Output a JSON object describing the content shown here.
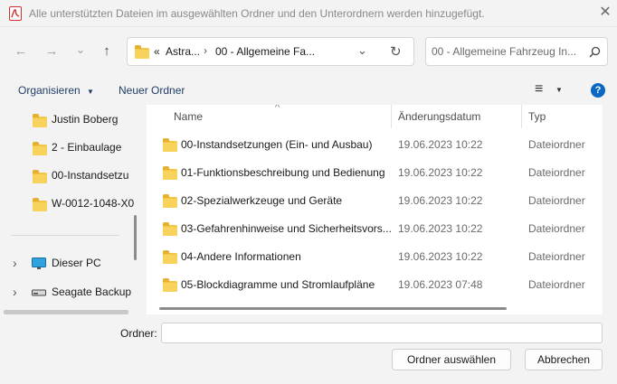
{
  "window": {
    "title": "Alle unterstützten Dateien im ausgewählten Ordner und den Unterordnern werden hinzugefügt.",
    "close_glyph": "✕"
  },
  "nav": {
    "back_glyph": "←",
    "forward_glyph": "→",
    "recent_glyph": "⌄",
    "up_glyph": "↑"
  },
  "address": {
    "overflow": "«",
    "crumbs": [
      "Astra...",
      "00 - Allgemeine Fa..."
    ],
    "separator": "›",
    "dropdown_glyph": "⌄",
    "refresh_glyph": "↻"
  },
  "search": {
    "placeholder": "00 - Allgemeine Fahrzeug In...",
    "icon": "search-icon"
  },
  "commands": {
    "organize": "Organisieren",
    "new_folder": "Neuer Ordner",
    "view_glyph": "≡",
    "help_glyph": "?"
  },
  "sidebar": {
    "folders": [
      "Justin Boberg",
      "2 - Einbaulage",
      "00-Instandsetzu",
      "W-0012-1048-X0"
    ],
    "devices": [
      {
        "label": "Dieser PC",
        "icon": "monitor-icon"
      },
      {
        "label": "Seagate Backup",
        "icon": "drive-icon"
      }
    ],
    "expand_glyph": "›"
  },
  "table": {
    "sort_glyph": "^",
    "headers": {
      "name": "Name",
      "date": "Änderungsdatum",
      "type": "Typ"
    },
    "rows": [
      {
        "name": "00-Instandsetzungen (Ein- und Ausbau)",
        "date": "19.06.2023 10:22",
        "type": "Dateiordner"
      },
      {
        "name": "01-Funktionsbeschreibung und Bedienung",
        "date": "19.06.2023 10:22",
        "type": "Dateiordner"
      },
      {
        "name": "02-Spezialwerkzeuge und Geräte",
        "date": "19.06.2023 10:22",
        "type": "Dateiordner"
      },
      {
        "name": "03-Gefahrenhinweise und Sicherheitsvors...",
        "date": "19.06.2023 10:22",
        "type": "Dateiordner"
      },
      {
        "name": "04-Andere Informationen",
        "date": "19.06.2023 10:22",
        "type": "Dateiordner"
      },
      {
        "name": "05-Blockdiagramme und Stromlaufpläne",
        "date": "19.06.2023 07:48",
        "type": "Dateiordner"
      }
    ]
  },
  "footer": {
    "folder_label": "Ordner:",
    "folder_value": "",
    "select_button": "Ordner auswählen",
    "cancel_button": "Abbrechen"
  },
  "colors": {
    "accent": "#0a67c2",
    "folder": "#f4c542",
    "pdf_red": "#d32f2f"
  }
}
